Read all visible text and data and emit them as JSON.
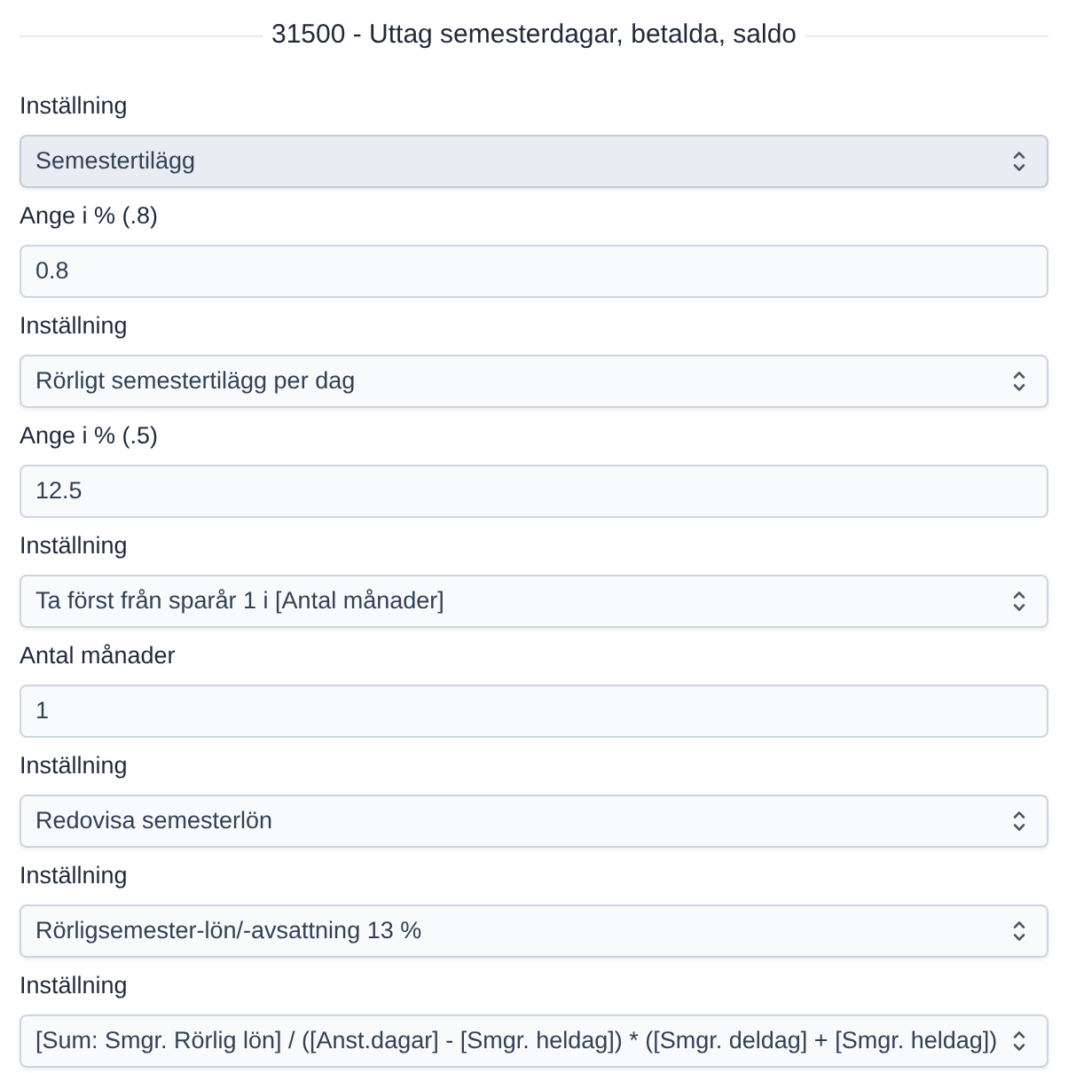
{
  "section": {
    "title": "31500 - Uttag semesterdagar, betalda, saldo"
  },
  "fields": [
    {
      "kind": "select",
      "label": "Inställning",
      "value": "Semestertilägg",
      "highlighted": true
    },
    {
      "kind": "input",
      "label": "Ange i % (.8)",
      "value": "0.8"
    },
    {
      "kind": "select",
      "label": "Inställning",
      "value": "Rörligt semestertilägg per dag",
      "highlighted": false
    },
    {
      "kind": "input",
      "label": "Ange i % (.5)",
      "value": "12.5"
    },
    {
      "kind": "select",
      "label": "Inställning",
      "value": "Ta först från sparår 1 i [Antal månader]",
      "highlighted": false
    },
    {
      "kind": "input",
      "label": "Antal månader",
      "value": "1"
    },
    {
      "kind": "select",
      "label": "Inställning",
      "value": "Redovisa semesterlön",
      "highlighted": false
    },
    {
      "kind": "select",
      "label": "Inställning",
      "value": "Rörligsemester-lön/-avsattning 13 %",
      "highlighted": false
    },
    {
      "kind": "select",
      "label": "Inställning",
      "value": "[Sum: Smgr. Rörlig lön] / ([Anst.dagar] - [Smgr. heldag]) * ([Smgr. deldag] + [Smgr. heldag])",
      "highlighted": false
    }
  ]
}
